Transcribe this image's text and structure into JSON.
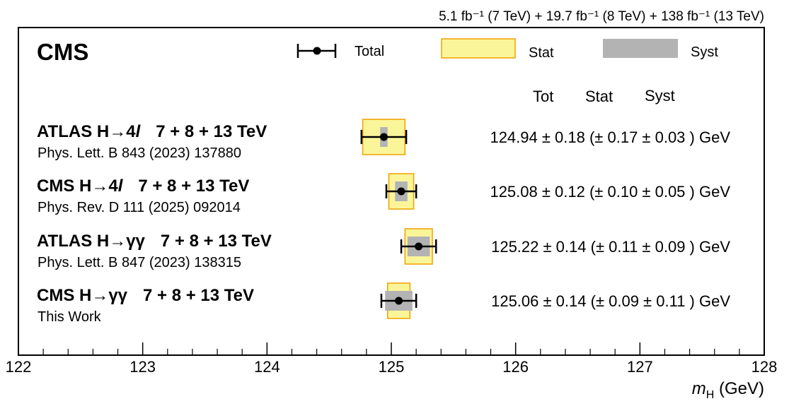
{
  "chart_data": {
    "type": "forest",
    "experiment_label": "CMS",
    "lumi_label": "5.1 fb⁻¹ (7 TeV) + 19.7 fb⁻¹ (8 TeV) + 138 fb⁻¹ (13 TeV)",
    "xlabel_var": "m",
    "xlabel_sub": "H",
    "xlabel_unit": " (GeV)",
    "xlim": [
      122,
      128
    ],
    "xticks": [
      "122",
      "123",
      "124",
      "125",
      "126",
      "127",
      "128"
    ],
    "legend": [
      {
        "name": "Total",
        "kind": "errorbar",
        "color": "#000000"
      },
      {
        "name": "Stat",
        "kind": "box",
        "color": "#fbf59a",
        "edge": "#f0a000"
      },
      {
        "name": "Syst",
        "kind": "box",
        "color": "#b3b3b3"
      }
    ],
    "column_headers": [
      "Tot",
      "Stat",
      "Syst"
    ],
    "unit": "GeV",
    "measurements": [
      {
        "name": "ATLAS H→4l",
        "energies": "7 + 8 + 13 TeV",
        "reference": "Phys. Lett. B 843 (2023) 137880",
        "value": 124.94,
        "tot": 0.18,
        "stat": 0.17,
        "syst": 0.03,
        "value_text": "124.94",
        "tot_text": "0.18",
        "stat_text": "0.17",
        "syst_text": "0.03"
      },
      {
        "name": "CMS H→4l",
        "energies": "7 + 8 + 13 TeV",
        "reference": "Phys. Rev. D 111 (2025) 092014",
        "value": 125.08,
        "tot": 0.12,
        "stat": 0.1,
        "syst": 0.05,
        "value_text": "125.08",
        "tot_text": "0.12",
        "stat_text": "0.10",
        "syst_text": "0.05"
      },
      {
        "name": "ATLAS H→γγ",
        "energies": "7 + 8 + 13 TeV",
        "reference": "Phys. Lett. B 847 (2023) 138315",
        "value": 125.22,
        "tot": 0.14,
        "stat": 0.11,
        "syst": 0.09,
        "value_text": "125.22",
        "tot_text": "0.14",
        "stat_text": "0.11",
        "syst_text": "0.09"
      },
      {
        "name": "CMS H→γγ",
        "energies": "7 + 8 + 13 TeV",
        "reference": "This Work",
        "value": 125.06,
        "tot": 0.14,
        "stat": 0.09,
        "syst": 0.11,
        "value_text": "125.06",
        "tot_text": "0.14",
        "stat_text": "0.09",
        "syst_text": "0.11"
      }
    ]
  }
}
